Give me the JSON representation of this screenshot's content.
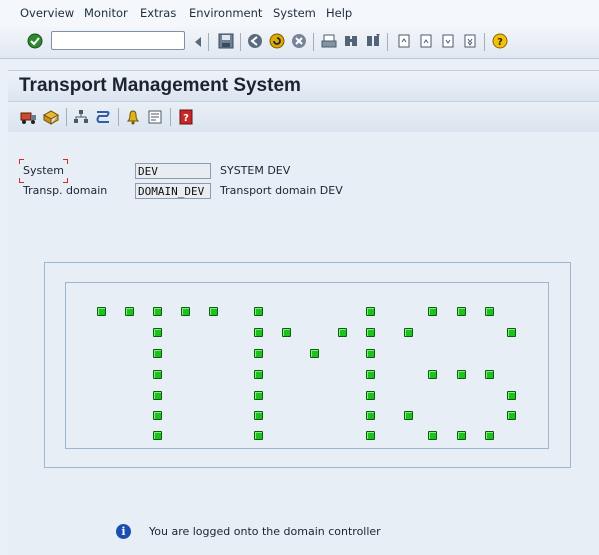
{
  "menu": [
    "Overview",
    "Monitor",
    "Extras",
    "Environment",
    "System",
    "Help"
  ],
  "command_field": {
    "value": ""
  },
  "title": "Transport Management System",
  "form": {
    "system_label": "System",
    "system_value": "DEV",
    "system_desc": "SYSTEM DEV",
    "domain_label": "Transp. domain",
    "domain_value": "DOMAIN_DEV",
    "domain_desc": "Transport domain DEV"
  },
  "status": {
    "message": "You are logged onto the domain controller"
  },
  "colors": {
    "indicator": "#1ec11e",
    "accent": "#1a4eb0"
  },
  "logo_text": "TMS"
}
